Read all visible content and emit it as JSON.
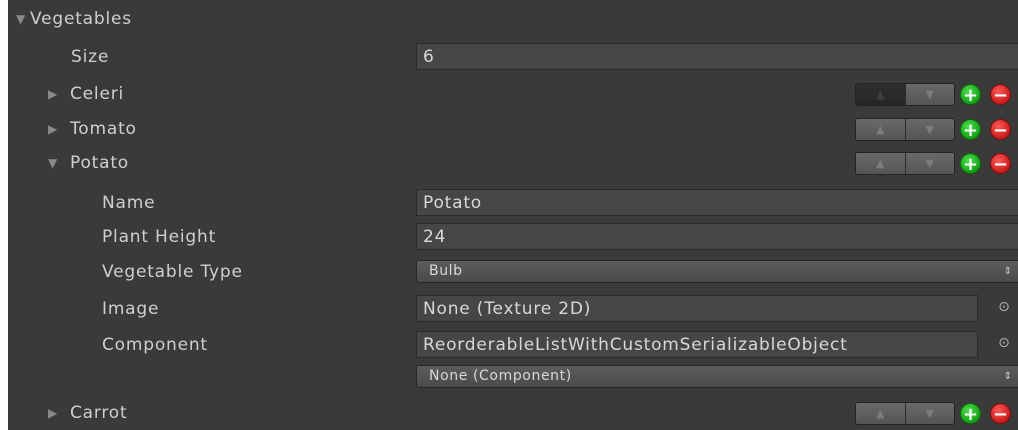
{
  "inspector": {
    "list_label": "Vegetables",
    "size_label": "Size",
    "size_value": "6",
    "items": [
      {
        "label": "Celeri",
        "expanded": false
      },
      {
        "label": "Tomato",
        "expanded": false
      },
      {
        "label": "Potato",
        "expanded": true
      },
      {
        "label": "Carrot",
        "expanded": false
      }
    ],
    "potato": {
      "name_label": "Name",
      "name_value": "Potato",
      "plant_height_label": "Plant Height",
      "plant_height_value": "24",
      "vegetable_type_label": "Vegetable Type",
      "vegetable_type_value": "Bulb",
      "image_label": "Image",
      "image_value": "None (Texture 2D)",
      "component_label": "Component",
      "component_value": "ReorderableListWithCustomSerializableObject",
      "component_sub_value": "None (Component)"
    }
  },
  "icons": {
    "collapsed": "▶",
    "expanded": "▼",
    "move_up": "▲",
    "move_down": "▼",
    "add": "+",
    "remove": "−",
    "object_picker": "⊙",
    "dropdown_arrows": "⇕"
  },
  "colors": {
    "panel_bg": "#3a3a3a",
    "field_bg": "#464646",
    "text": "#cfcfcf",
    "add_green": "#15a015",
    "remove_red": "#c81a1a"
  }
}
